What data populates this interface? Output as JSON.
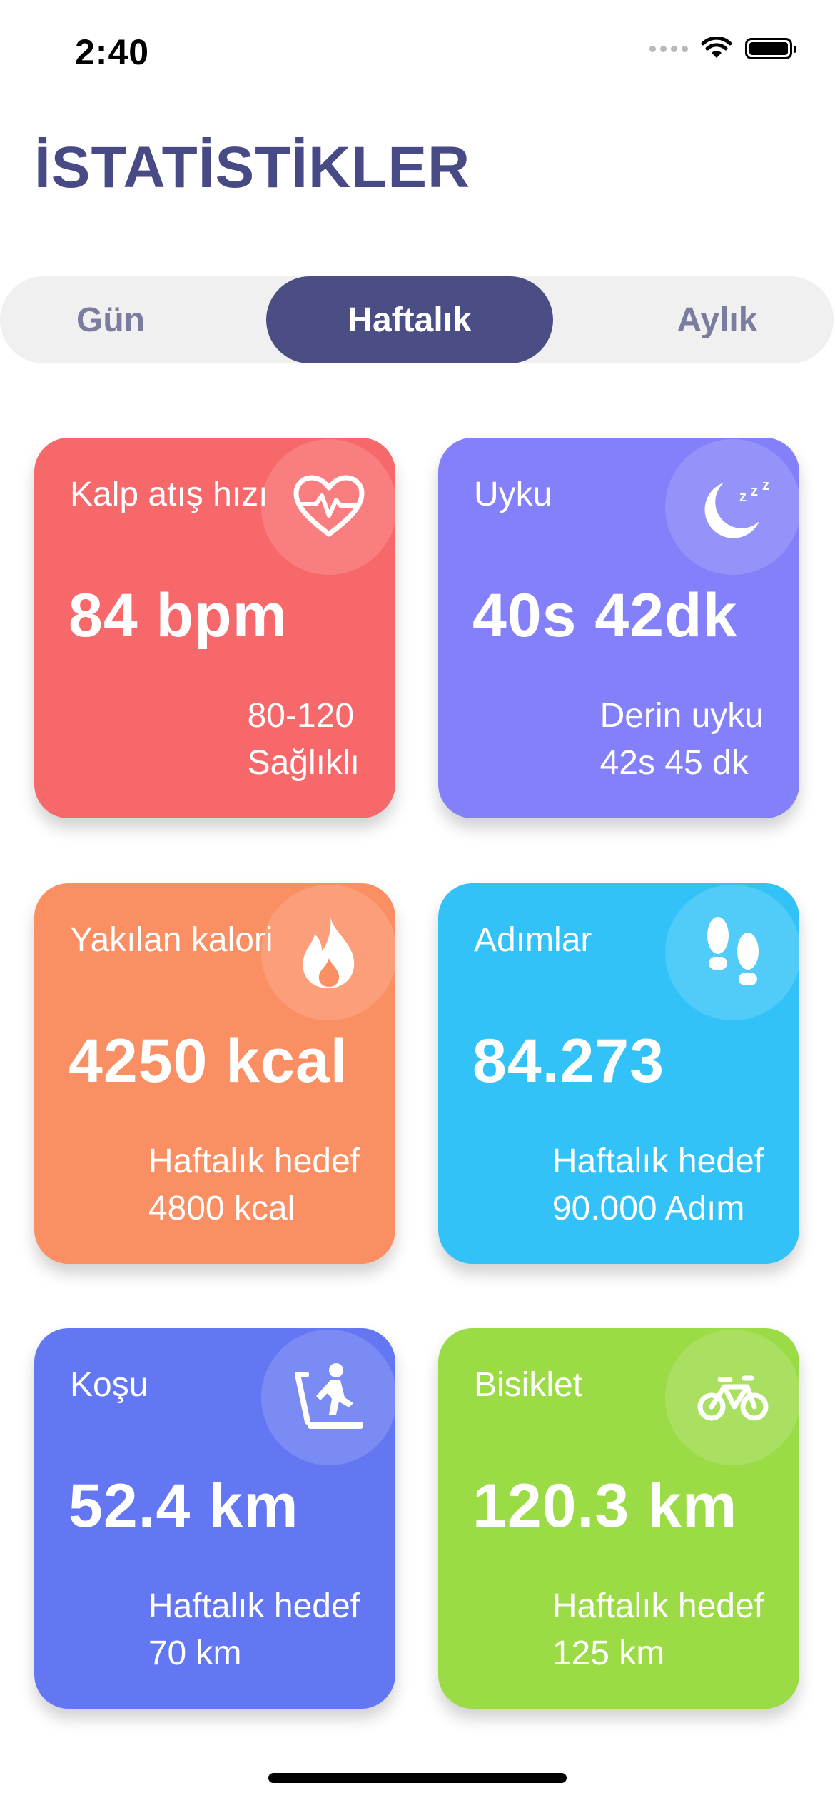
{
  "status_bar": {
    "time": "2:40"
  },
  "page": {
    "title": "İSTATİSTİKLER"
  },
  "tabs": {
    "day": "Gün",
    "week": "Haftalık",
    "month": "Aylık",
    "selected": "Haftalık"
  },
  "cards": {
    "heart": {
      "title": "Kalp atış hızı",
      "value": "84 bpm",
      "sub1": "80-120",
      "sub2": "Sağlıklı",
      "icon": "heart-pulse-icon",
      "color": "#f7686a"
    },
    "sleep": {
      "title": "Uyku",
      "value": "40s 42dk",
      "sub1": "Derin uyku",
      "sub2": "42s 45 dk",
      "icon": "moon-zzz-icon",
      "color": "#8380f9"
    },
    "calories": {
      "title": "Yakılan kalori",
      "value": "4250 kcal",
      "sub1": "Haftalık hedef",
      "sub2": "4800 kcal",
      "icon": "flame-icon",
      "color": "#f98f62"
    },
    "steps": {
      "title": "Adımlar",
      "value": "84.273",
      "sub1": "Haftalık hedef",
      "sub2": "90.000 Adım",
      "icon": "footprints-icon",
      "color": "#33c2f7"
    },
    "run": {
      "title": "Koşu",
      "value": "52.4 km",
      "sub1": "Haftalık hedef",
      "sub2": "70 km",
      "icon": "treadmill-icon",
      "color": "#6477f3"
    },
    "bike": {
      "title": "Bisiklet",
      "value": "120.3 km",
      "sub1": "Haftalık hedef",
      "sub2": "125 km",
      "icon": "bicycle-icon",
      "color": "#9bdb46"
    }
  }
}
